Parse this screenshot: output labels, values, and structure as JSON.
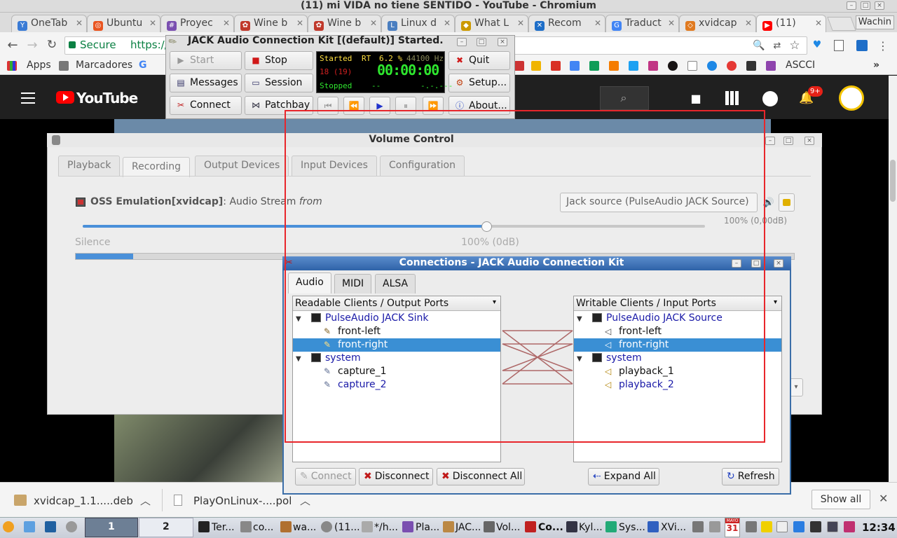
{
  "browser": {
    "window_title": "(11) mi VIDA no tiene SENTIDO - YouTube - Chromium",
    "profile": "Wachin",
    "tabs": [
      {
        "label": "OneTab",
        "color": "#3a7bd5"
      },
      {
        "label": "Ubuntu",
        "color": "#e95420"
      },
      {
        "label": "Proyec",
        "color": "#7a4fb0"
      },
      {
        "label": "Wine b",
        "color": "#c0392b"
      },
      {
        "label": "Wine b",
        "color": "#c0392b"
      },
      {
        "label": "Linux d",
        "color": "#4a7ec0"
      },
      {
        "label": "What L",
        "color": "#cc9900"
      },
      {
        "label": "Recom",
        "color": "#1e6ec8"
      },
      {
        "label": "Traduct",
        "color": "#4285f4"
      },
      {
        "label": "xvidcap",
        "color": "#e07a20"
      },
      {
        "label": "(11)",
        "color": "#ff0000"
      }
    ],
    "secure_label": "Secure",
    "url": "https://",
    "bookmarks": {
      "apps": "Apps",
      "marcadores": "Marcadores",
      "ascci": "ASCCI"
    }
  },
  "youtube": {
    "logo": "YouTube",
    "notifications": "9+"
  },
  "downloads": {
    "items": [
      "xvidcap_1.1.....deb",
      "PlayOnLinux-....pol"
    ],
    "show_all": "Show all"
  },
  "jack": {
    "title": "JACK Audio Connection Kit [(default)] Started.",
    "buttons": {
      "start": "Start",
      "stop": "Stop",
      "quit": "Quit",
      "messages": "Messages",
      "session": "Session",
      "setup": "Setup...",
      "connect": "Connect",
      "patchbay": "Patchbay",
      "about": "About..."
    },
    "display": {
      "status": "Started",
      "rt": "RT",
      "dsp": "6.2 %",
      "rate": "44100 Hz",
      "xruns": "18 (19)",
      "time": "00:00:00",
      "transport": "Stopped",
      "dash1": "--",
      "dash2": "-.-.---"
    }
  },
  "volume": {
    "title": "Volume Control",
    "tabs": [
      "Playback",
      "Recording",
      "Output Devices",
      "Input Devices",
      "Configuration"
    ],
    "active_tab": "Recording",
    "stream_app": "OSS Emulation[xvidcap]",
    "stream_desc": ": Audio Stream ",
    "stream_from": "from",
    "device": "Jack source (PulseAudio JACK Source)",
    "level_text": "100% (0,00dB)",
    "silence": "Silence",
    "mid_mark": "100% (0dB)",
    "slider_fraction": 0.65,
    "meter_fraction": 0.08
  },
  "connections": {
    "title": "Connections - JACK Audio Connection Kit",
    "tabs": [
      "Audio",
      "MIDI",
      "ALSA"
    ],
    "active_tab": "Audio",
    "left_header": "Readable Clients / Output Ports",
    "right_header": "Writable Clients / Input Ports",
    "left": [
      {
        "type": "client",
        "label": "PulseAudio JACK Sink"
      },
      {
        "type": "port",
        "label": "front-left",
        "style": "normal"
      },
      {
        "type": "port",
        "label": "front-right",
        "style": "normal",
        "selected": true
      },
      {
        "type": "client",
        "label": "system"
      },
      {
        "type": "port",
        "label": "capture_1",
        "style": "normal"
      },
      {
        "type": "port",
        "label": "capture_2",
        "style": "blue"
      }
    ],
    "right": [
      {
        "type": "client",
        "label": "PulseAudio JACK Source"
      },
      {
        "type": "port",
        "label": "front-left",
        "style": "normal"
      },
      {
        "type": "port",
        "label": "front-right",
        "style": "normal",
        "selected": true
      },
      {
        "type": "client",
        "label": "system"
      },
      {
        "type": "port",
        "label": "playback_1",
        "style": "normal"
      },
      {
        "type": "port",
        "label": "playback_2",
        "style": "blue"
      }
    ],
    "buttons": {
      "connect": "Connect",
      "disconnect": "Disconnect",
      "disconnect_all": "Disconnect All",
      "expand_all": "Expand All",
      "refresh": "Refresh"
    }
  },
  "taskbar": {
    "workspace1": "1",
    "workspace2": "2",
    "items": [
      "Ter...",
      "co...",
      "wa...",
      "(11...",
      "*/h...",
      "Pla...",
      "JAC...",
      "Vol...",
      "Co...",
      "Kyl...",
      "Sys...",
      "XVi..."
    ],
    "calendar_month": "MAYO",
    "calendar_day": "31",
    "clock": "12:34"
  }
}
